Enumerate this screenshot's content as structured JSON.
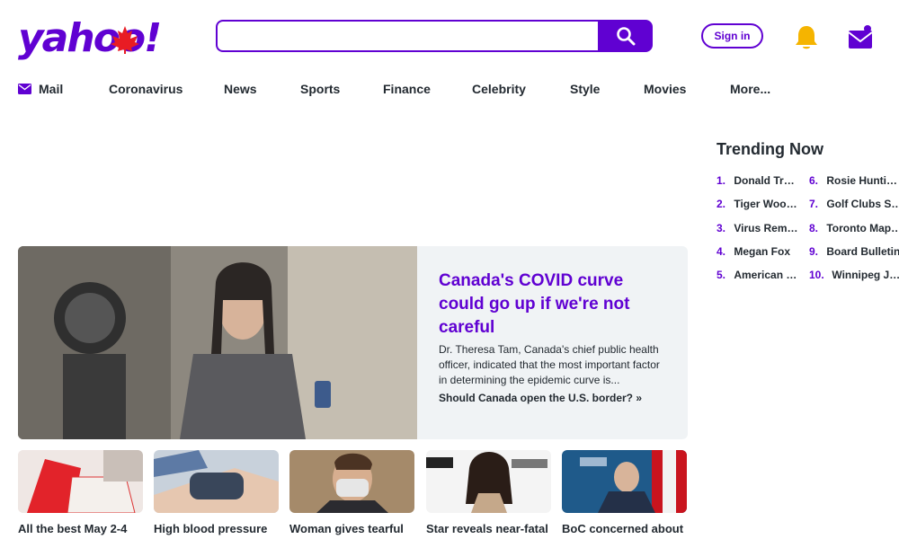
{
  "header": {
    "logo_text": "yahoo!",
    "search": {
      "value": "",
      "placeholder": ""
    },
    "signin_label": "Sign in",
    "accent_color": "#6001d2"
  },
  "nav": {
    "items": [
      {
        "label": "Mail",
        "icon": "mail-icon"
      },
      {
        "label": "Coronavirus"
      },
      {
        "label": "News"
      },
      {
        "label": "Sports"
      },
      {
        "label": "Finance"
      },
      {
        "label": "Celebrity"
      },
      {
        "label": "Style"
      },
      {
        "label": "Movies"
      },
      {
        "label": "More..."
      }
    ]
  },
  "hero": {
    "title": "Canada's COVID curve could go up if we're not careful",
    "summary": "Dr. Theresa Tam, Canada's chief public health officer, indicated that the most important factor in determining the epidemic curve is...",
    "link": "Should Canada open the U.S. border? »"
  },
  "cards": [
    {
      "title": "All the best May 2-4"
    },
    {
      "title": "High blood pressure"
    },
    {
      "title": "Woman gives tearful"
    },
    {
      "title": "Star reveals near-fatal"
    },
    {
      "title": "BoC concerned about"
    }
  ],
  "trending": {
    "title": "Trending Now",
    "items": [
      {
        "rank": "1.",
        "label": "Donald Trump"
      },
      {
        "rank": "2.",
        "label": "Tiger Woods"
      },
      {
        "rank": "3.",
        "label": "Virus Removal"
      },
      {
        "rank": "4.",
        "label": "Megan Fox"
      },
      {
        "rank": "5.",
        "label": "American Idol"
      },
      {
        "rank": "6.",
        "label": "Rosie Huntington"
      },
      {
        "rank": "7.",
        "label": "Golf Clubs Sale"
      },
      {
        "rank": "8.",
        "label": "Toronto Maple Leafs"
      },
      {
        "rank": "9.",
        "label": "Board Bulletin"
      },
      {
        "rank": "10.",
        "label": "Winnipeg Jets"
      }
    ]
  }
}
